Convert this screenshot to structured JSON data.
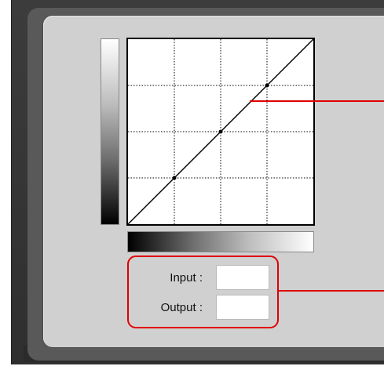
{
  "curves_panel": {
    "input_label": "Input :",
    "output_label": "Output :",
    "input_value": "",
    "output_value": ""
  },
  "curve": {
    "type": "linear-identity",
    "grid_divisions": 4,
    "control_points": [
      [
        0.25,
        0.25
      ],
      [
        0.5,
        0.5
      ],
      [
        0.75,
        0.75
      ]
    ]
  },
  "colors": {
    "callout": "#e00000",
    "panel_background": "#d0d0d0",
    "frame": "#3c3c3c"
  },
  "icons": {
    "tone_gradient_vertical": "output-gradient-bar",
    "tone_gradient_horizontal": "input-gradient-bar"
  }
}
